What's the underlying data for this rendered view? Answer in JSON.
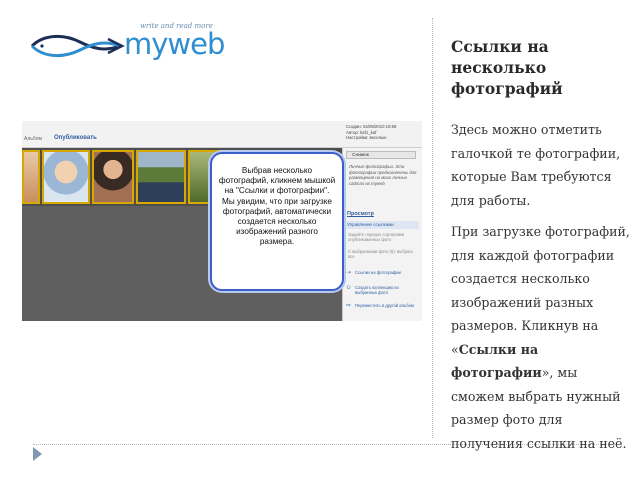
{
  "logo": {
    "tagline": "write and read more",
    "wordmark": "myweb",
    "brand_color": "#2f8ed0"
  },
  "slide": {
    "title": "Ссылки на несколько фотографий",
    "paragraph1": "Здесь можно отметить галочкой те фотографии, которые Вам требуются для работы.",
    "paragraph2_pre": "При загрузке фотографий, для каждой фотографии создается несколько изображений разных размеров. Кликнув на «",
    "paragraph2_bold": "Ссылки на фотографии",
    "paragraph2_post": "», мы сможем выбрать нужный размер фото для получения ссылки на неё."
  },
  "screenshot": {
    "breadcrumb": "Альбом",
    "top_link": "Опубликовать",
    "meta_lines": [
      "Создан: 04/09/2010 19:59",
      "Автор: kaf1_kaf",
      "Настройки: веселые"
    ],
    "side_button": "Снимок",
    "side_note": "Личные фотографии. Эти фотографии предназначены для размещения на моих личных сайтах на myweb",
    "preview_link": "Просмотр",
    "panel_header": "Управление ссылками",
    "item1": "Задайте порядок сортировки опубликованных фото",
    "item2": "С выбранными фото (6): выбрать все",
    "action1": "Ссылки на фотографии",
    "action2": "Создать коллекцию из выбранных фото",
    "action3": "Переместить в другой альбом",
    "callout": "Выбрав несколько фотографий, кликнем мышкой на \"Ссылки и фотографии\". Мы увидим, что при загрузке фотографий, автоматически создается несколько изображений разного размера."
  },
  "colors": {
    "callout_border": "#3b5fc7",
    "photo_border": "#d8a800",
    "link_blue": "#2f5fa0"
  }
}
